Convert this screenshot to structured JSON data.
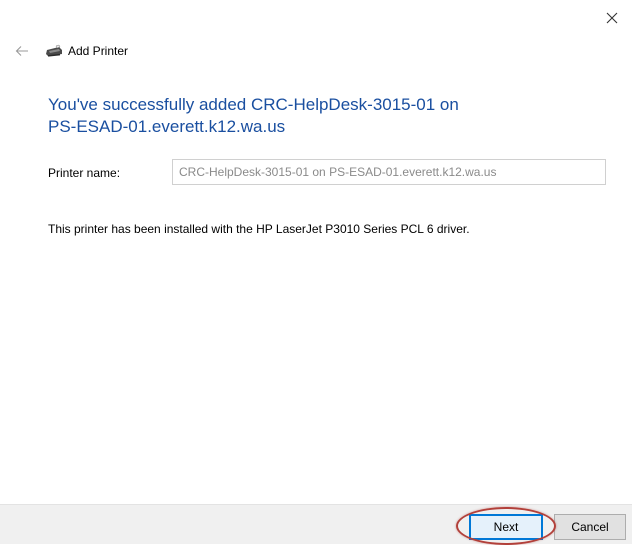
{
  "window": {
    "title": "Add Printer",
    "close_icon": "close-icon",
    "back_icon": "back-arrow-icon",
    "printer_icon": "printer-icon"
  },
  "main": {
    "heading_line1": "You've successfully added CRC-HelpDesk-3015-01 on",
    "heading_line2": "PS-ESAD-01.everett.k12.wa.us",
    "printer_name_label": "Printer name:",
    "printer_name_value": "CRC-HelpDesk-3015-01 on PS-ESAD-01.everett.k12.wa.us",
    "driver_info": "This printer has been installed with the HP LaserJet P3010 Series PCL 6 driver."
  },
  "footer": {
    "next_label": "Next",
    "cancel_label": "Cancel"
  },
  "colors": {
    "heading": "#1a4fa0",
    "highlight_ring": "#b2403a",
    "footer_bg": "#f0f0f0"
  }
}
